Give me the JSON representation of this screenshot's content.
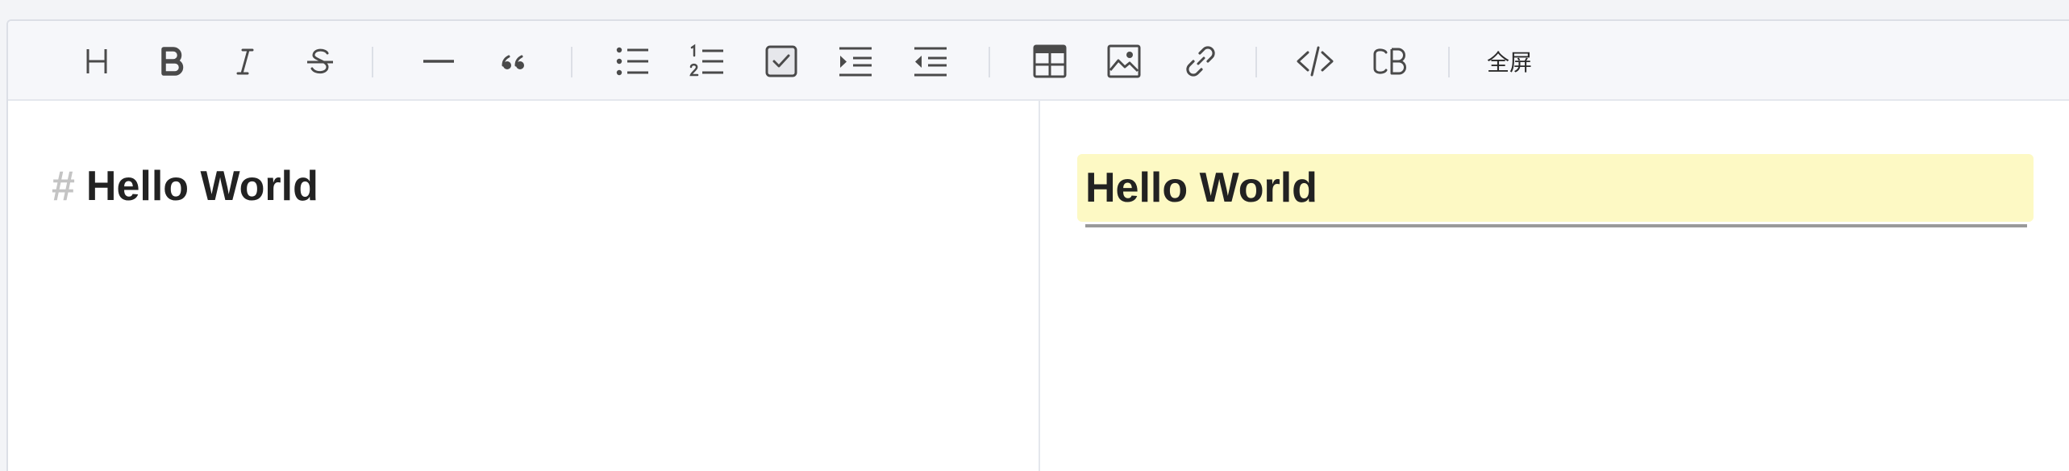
{
  "toolbar": {
    "buttons": [
      {
        "id": "heading",
        "icon": "heading-icon",
        "title": "H"
      },
      {
        "id": "bold",
        "icon": "bold-icon",
        "title": "B"
      },
      {
        "id": "italic",
        "icon": "italic-icon",
        "title": "I"
      },
      {
        "id": "strikethrough",
        "icon": "strikethrough-icon",
        "title": "S"
      },
      {
        "id": "horizontal-rule",
        "icon": "horizontal-rule-icon"
      },
      {
        "id": "quote",
        "icon": "quote-icon"
      },
      {
        "id": "bullet-list",
        "icon": "bullet-list-icon"
      },
      {
        "id": "ordered-list",
        "icon": "ordered-list-icon"
      },
      {
        "id": "checklist",
        "icon": "checkbox-icon"
      },
      {
        "id": "indent",
        "icon": "indent-icon"
      },
      {
        "id": "outdent",
        "icon": "outdent-icon"
      },
      {
        "id": "table",
        "icon": "table-icon"
      },
      {
        "id": "image",
        "icon": "image-icon"
      },
      {
        "id": "link",
        "icon": "link-icon"
      },
      {
        "id": "code",
        "icon": "code-icon"
      },
      {
        "id": "code-block",
        "icon": "code-block-icon",
        "label": "CB"
      }
    ],
    "fullscreen_label": "全屏"
  },
  "editor": {
    "markdown_prefix": "#",
    "markdown_text": "Hello World"
  },
  "preview": {
    "heading_text": "Hello World"
  },
  "colors": {
    "icon": "#4a4a4a",
    "toolbar_bg": "#f6f7fa",
    "heading_highlight": "#fdf9c4",
    "hash_marker": "#c4c4c4"
  }
}
